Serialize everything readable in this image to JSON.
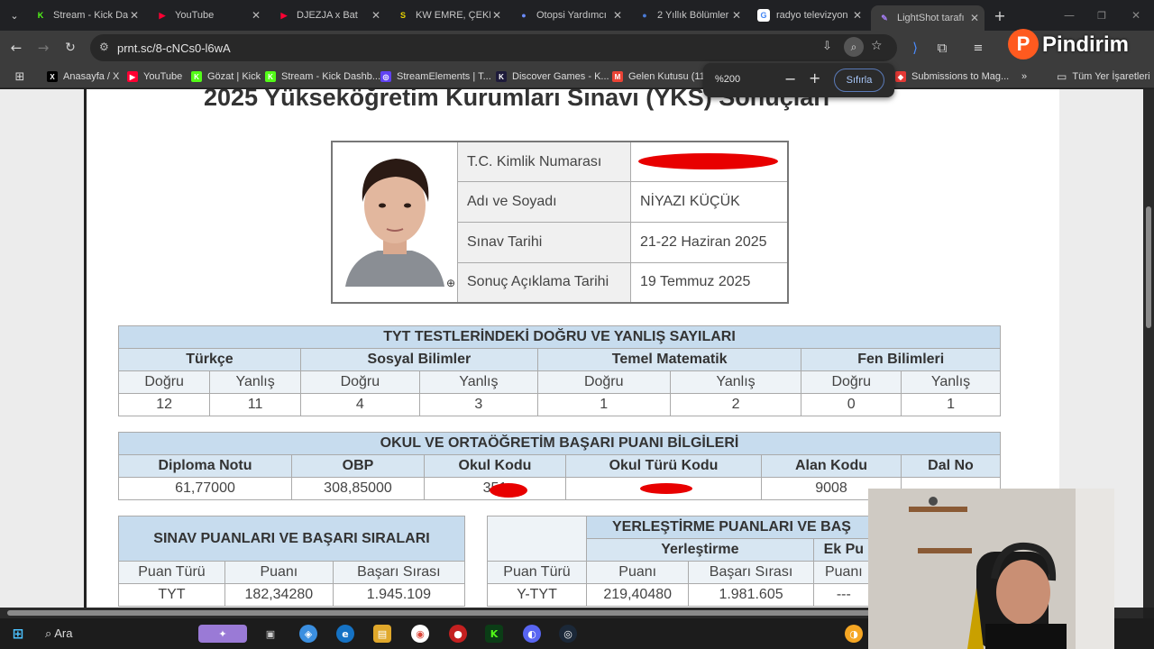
{
  "browser": {
    "tabs": [
      {
        "label": "Stream - Kick Da",
        "icon": "K",
        "color": "#53fc18"
      },
      {
        "label": "YouTube",
        "icon": "▶",
        "color": "#ff0033"
      },
      {
        "label": "DJEZJA x Bat",
        "icon": "▶",
        "color": "#ff0033"
      },
      {
        "label": "KW EMRE, ÇEKM",
        "icon": "S",
        "color": "#e8d400"
      },
      {
        "label": "Otopsi Yardımcı",
        "icon": "●",
        "color": "#6b8cff"
      },
      {
        "label": "2 Yıllık Bölümler",
        "icon": "●",
        "color": "#4a7bd8"
      },
      {
        "label": "radyo televizyon",
        "icon": "G",
        "color": "#ffffff"
      },
      {
        "label": "LightShot tarafı",
        "icon": "✎",
        "color": "#a37cf0"
      }
    ],
    "new_tab": "+",
    "url": "prnt.sc/8-cNCs0-l6wA",
    "brand_overlay": "Pindirim",
    "zoom": {
      "label": "%200",
      "reset_label": "Sıfırla"
    },
    "bookmarks": [
      {
        "label": "Anasayfa / X",
        "icon": "X",
        "color": "#000000"
      },
      {
        "label": "YouTube",
        "icon": "▶",
        "color": "#ff0033"
      },
      {
        "label": "Gözat | Kick",
        "icon": "K",
        "color": "#53fc18"
      },
      {
        "label": "Stream - Kick Dashb...",
        "icon": "K",
        "color": "#53fc18"
      },
      {
        "label": "StreamElements | T...",
        "icon": "◎",
        "color": "#6042f2"
      },
      {
        "label": "Discover Games - K...",
        "icon": "K",
        "color": "#1e1b3a"
      },
      {
        "label": "Gelen Kutusu (111)",
        "icon": "M",
        "color": "#ea4335"
      },
      {
        "label": "Submissions to Mag...",
        "icon": "◆",
        "color": "#e53935"
      }
    ],
    "bookmarks_more": "»",
    "all_bookmarks": "Tüm Yer İşaretleri"
  },
  "document": {
    "title": "2025 Yükseköğretim Kurumları Sınavı (YKS) Sonuçları",
    "info": [
      {
        "label": "T.C. Kimlik Numarası",
        "value": ""
      },
      {
        "label": "Adı ve Soyadı",
        "value": "NİYAZI KÜÇÜK"
      },
      {
        "label": "Sınav Tarihi",
        "value": "21-22 Haziran 2025"
      },
      {
        "label": "Sonuç Açıklama Tarihi",
        "value": "19 Temmuz 2025"
      }
    ],
    "tyt": {
      "title": "TYT TESTLERİNDEKİ DOĞRU VE YANLIŞ SAYILARI",
      "subjects": [
        "Türkçe",
        "Sosyal Bilimler",
        "Temel Matematik",
        "Fen Bilimleri"
      ],
      "dogru": "Doğru",
      "yanlis": "Yanlış",
      "values": [
        "12",
        "11",
        "4",
        "3",
        "1",
        "2",
        "0",
        "1"
      ]
    },
    "okul": {
      "title": "OKUL VE ORTAÖĞRETİM BAŞARI PUANI BİLGİLERİ",
      "headers": [
        "Diploma Notu",
        "OBP",
        "Okul Kodu",
        "Okul Türü Kodu",
        "Alan Kodu",
        "Dal No"
      ],
      "values": [
        "61,77000",
        "308,85000",
        "351",
        "",
        "9008",
        ""
      ]
    },
    "sinav": {
      "title": "SINAV PUANLARI VE BAŞARI SIRALARI",
      "headers": [
        "Puan Türü",
        "Puanı",
        "Başarı Sırası"
      ],
      "row": [
        "TYT",
        "182,34280",
        "1.945.109"
      ]
    },
    "yerlestirme": {
      "title": "YERLEŞTİRME PUANLARI VE BAŞ",
      "group1": "Yerleştirme",
      "group2": "Ek Pu",
      "headers": [
        "Puan Türü",
        "Puanı",
        "Başarı Sırası",
        "Puanı"
      ],
      "row": [
        "Y-TYT",
        "219,40480",
        "1.981.605",
        "---"
      ]
    }
  },
  "taskbar": {
    "search_label": "Ara"
  }
}
